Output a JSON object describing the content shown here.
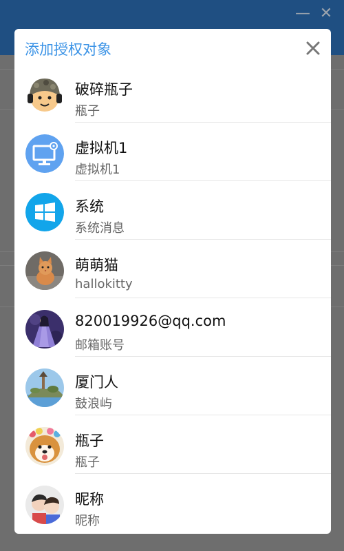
{
  "window": {
    "minimize_icon": "minimize-icon",
    "close_icon": "close-icon"
  },
  "dialog": {
    "title": "添加授权对象",
    "close_icon": "close-icon",
    "accent_color": "#3b93e6"
  },
  "items": [
    {
      "name": "破碎瓶子",
      "sub": "瓶子",
      "avatar": "soldier-cartoon-avatar"
    },
    {
      "name": "虚拟机1",
      "sub": "虚拟机1",
      "avatar": "monitor-gear-icon"
    },
    {
      "name": "系统",
      "sub": "系统消息",
      "avatar": "windows-logo-icon"
    },
    {
      "name": "萌萌猫",
      "sub": "hallokitty",
      "avatar": "kitten-photo-avatar"
    },
    {
      "name": "820019926@qq.com",
      "sub": "邮箱账号",
      "avatar": "purple-dress-photo-avatar"
    },
    {
      "name": "厦门人",
      "sub": "鼓浪屿",
      "avatar": "island-photo-avatar"
    },
    {
      "name": "瓶子",
      "sub": "瓶子",
      "avatar": "shiba-dog-photo-avatar"
    },
    {
      "name": "昵称",
      "sub": "昵称",
      "avatar": "children-photo-avatar"
    }
  ]
}
